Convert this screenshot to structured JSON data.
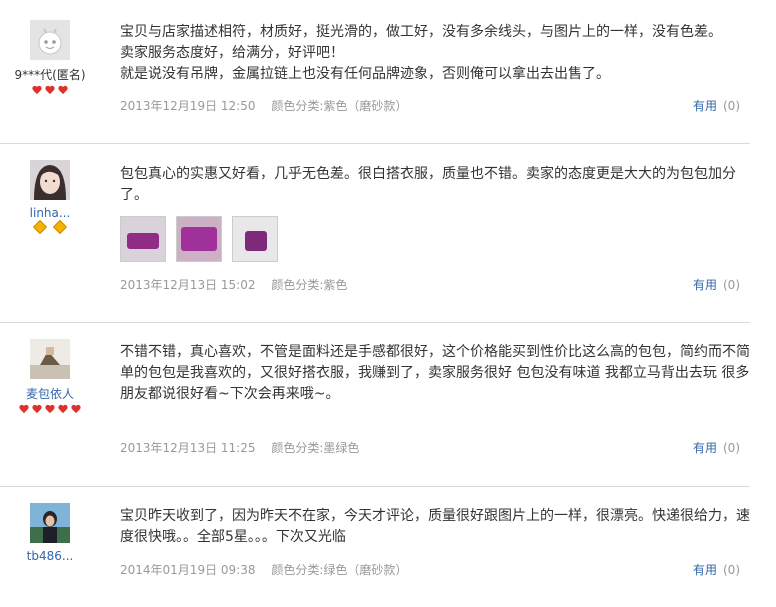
{
  "reviews": [
    {
      "user": "9***代(匿名)",
      "rank": "hearts",
      "rank_count": 3,
      "lines": [
        "宝贝与店家描述相符，材质好，挺光滑的，做工好，没有多余线头，与图片上的一样，没有色差。",
        "卖家服务态度好，给满分，好评吧！",
        "就是说没有吊牌，金属拉链上也没有任何品牌迹象，否则俺可以拿出去出售了。"
      ],
      "date": "2013年12月19日 12:50",
      "sku": "颜色分类:紫色（磨砂款）",
      "useful_label": "有用",
      "useful_count": "(0)"
    },
    {
      "user": "linha...",
      "rank": "gems",
      "rank_count": 2,
      "lines": [
        "包包真心的实惠又好看，几乎无色差。很白搭衣服，质量也不错。卖家的态度更是大大的为包包加分了。"
      ],
      "photos": 3,
      "date": "2013年12月13日 15:02",
      "sku": "颜色分类:紫色",
      "useful_label": "有用",
      "useful_count": "(0)"
    },
    {
      "user": "麦包依人",
      "rank": "hearts",
      "rank_count": 5,
      "lines": [
        "不错不错，真心喜欢，不管是面料还是手感都很好，这个价格能买到性价比这么高的包包，简约而不简单的包包是我喜欢的，又很好搭衣服，我赚到了，卖家服务很好 包包没有味道 我都立马背出去玩 很多朋友都说很好看~下次会再来哦~。"
      ],
      "date": "2013年12月13日 11:25",
      "sku": "颜色分类:墨绿色",
      "useful_label": "有用",
      "useful_count": "(0)"
    },
    {
      "user": "tb486...",
      "rank": "none",
      "rank_count": 0,
      "lines": [
        "宝贝昨天收到了，因为昨天不在家，今天才评论，质量很好跟图片上的一样，很漂亮。快递很给力，速度很快哦。。全部5星。。。下次又光临"
      ],
      "date": "2014年01月19日 09:38",
      "sku": "颜色分类:绿色（磨砂款）",
      "useful_label": "有用",
      "useful_count": "(0)"
    }
  ]
}
